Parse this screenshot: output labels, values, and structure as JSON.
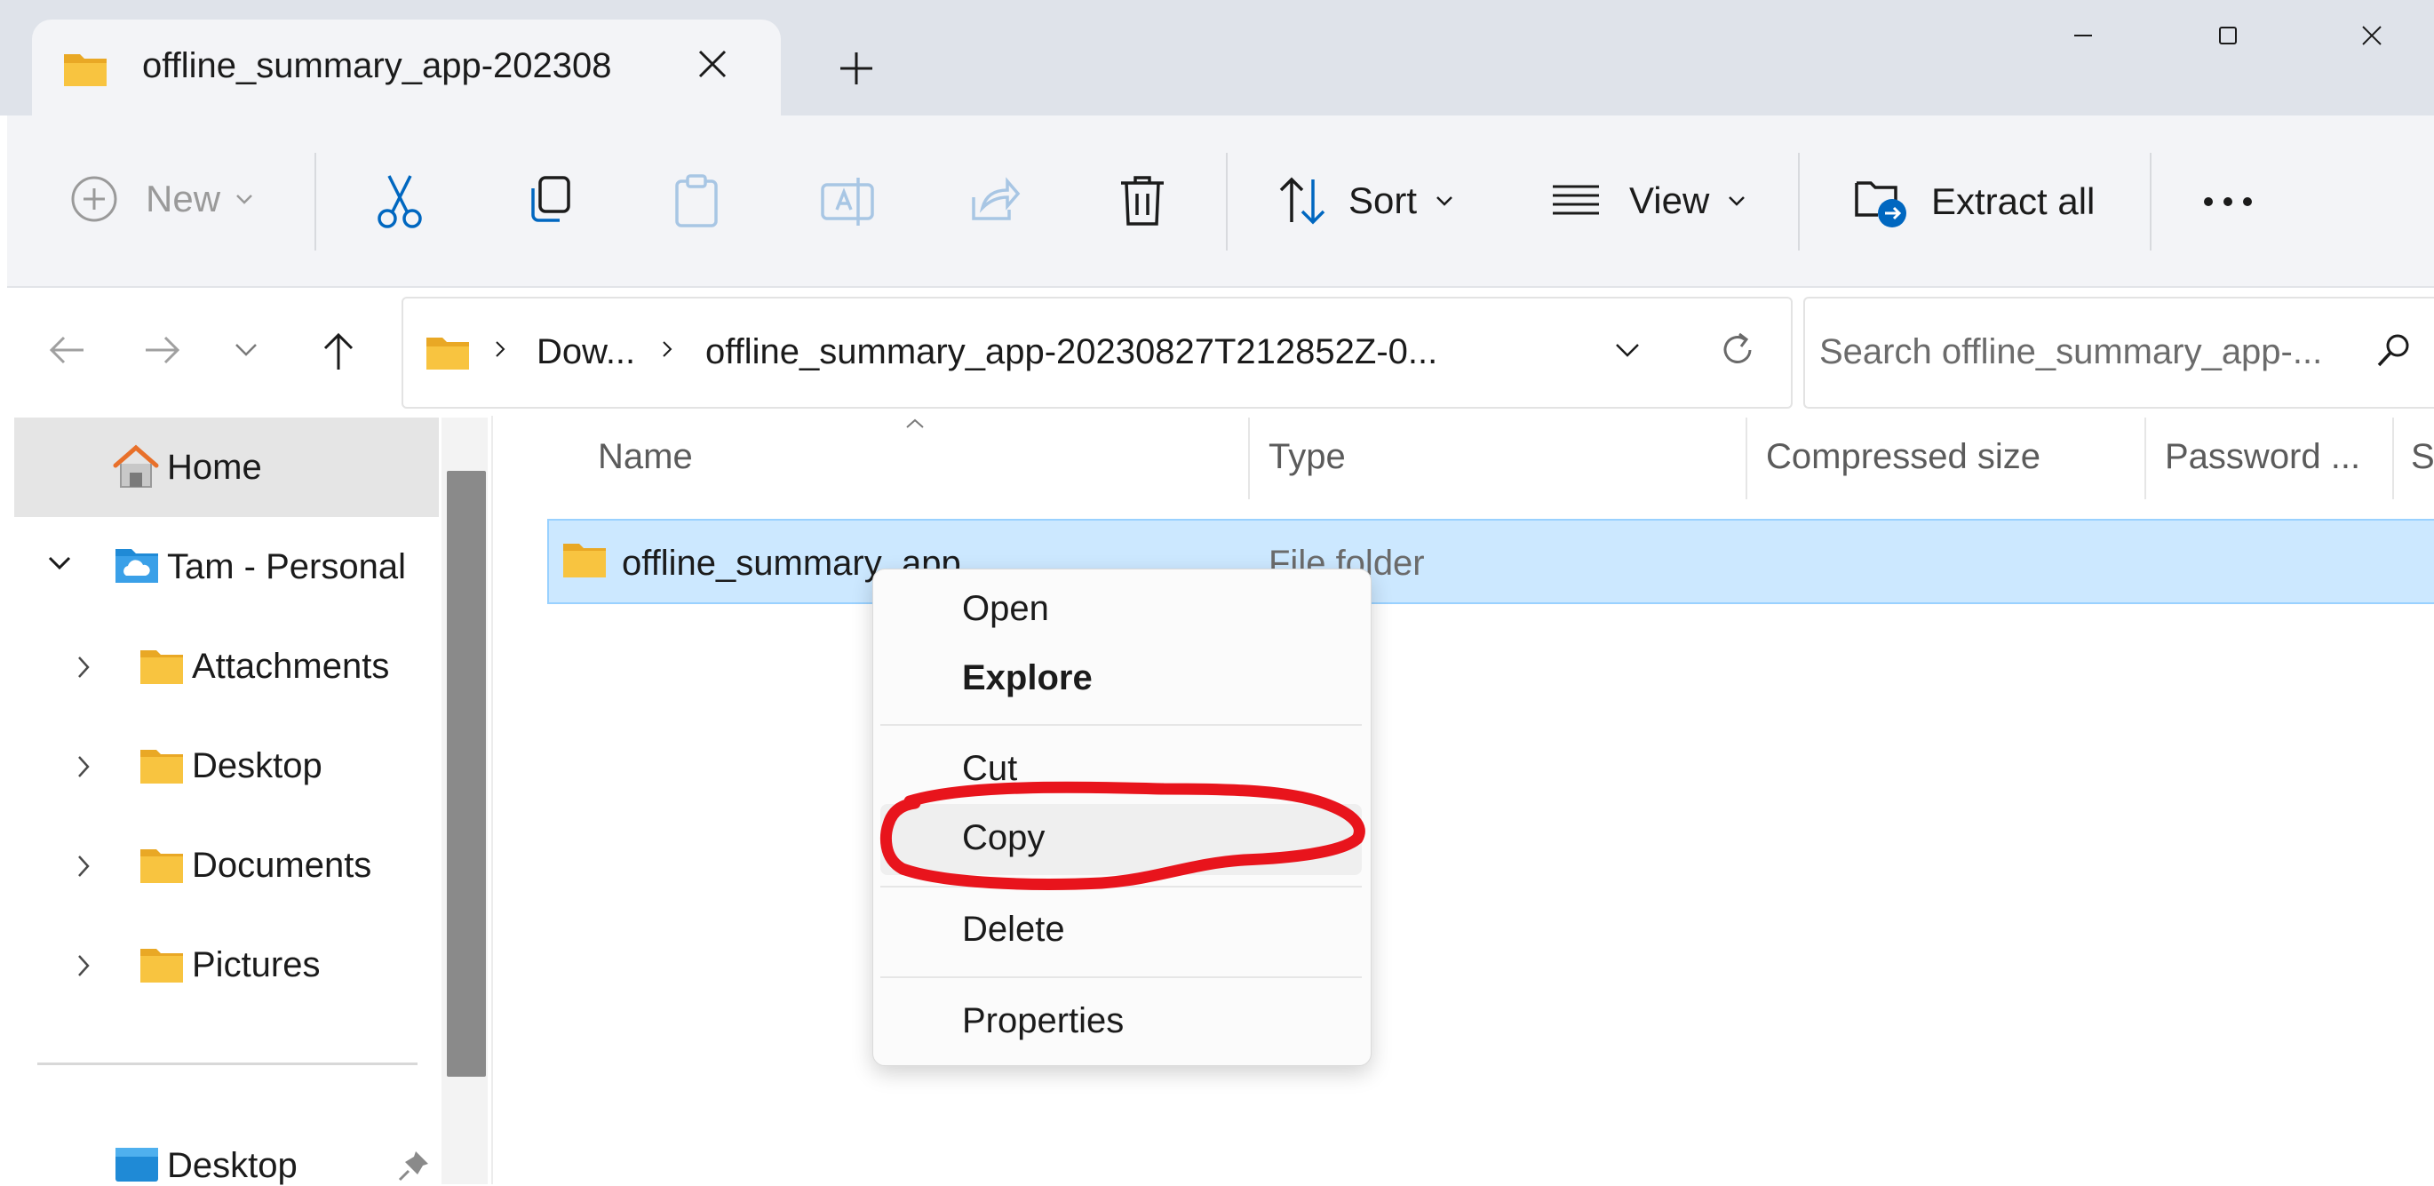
{
  "window": {
    "tab_title": "offline_summary_app-202308",
    "controls": [
      "minimize",
      "maximize",
      "close"
    ]
  },
  "toolbar": {
    "new_label": "New",
    "sort_label": "Sort",
    "view_label": "View",
    "extract_label": "Extract all",
    "icons": [
      "plus-icon",
      "cut-icon",
      "copy-icon",
      "paste-icon",
      "rename-icon",
      "share-icon",
      "delete-icon",
      "sort-icon",
      "view-icon",
      "extract-icon",
      "more-icon"
    ]
  },
  "address": {
    "crumbs": [
      "Dow...",
      "offline_summary_app-20230827T212852Z-0..."
    ],
    "search_placeholder": "Search offline_summary_app-..."
  },
  "sidebar": {
    "home": "Home",
    "cloud": "Tam - Personal",
    "items": [
      "Attachments",
      "Desktop",
      "Documents",
      "Pictures"
    ],
    "pinned": "Desktop"
  },
  "columns": [
    "Name",
    "Type",
    "Compressed size",
    "Password ...",
    "S"
  ],
  "files": [
    {
      "name": "offline_summary_app",
      "type": "File folder"
    }
  ],
  "context_menu": {
    "items": [
      "Open",
      "Explore",
      "Cut",
      "Copy",
      "Delete",
      "Properties"
    ],
    "highlighted": "Copy",
    "annotation_color": "#e8141c"
  },
  "colors": {
    "accent": "#0067c0",
    "selection": "#cce8ff",
    "folder": "#f8c440"
  }
}
